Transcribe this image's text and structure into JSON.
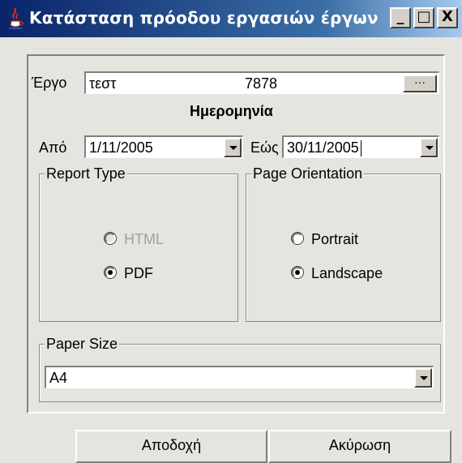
{
  "window": {
    "title": "Κατάσταση πρόοδου εργασιών έργων",
    "minimize_glyph": "_",
    "maximize_glyph": "□",
    "close_glyph": "X"
  },
  "project": {
    "label": "Έργο",
    "name": "τεστ",
    "code": "7878",
    "browse_label": "···"
  },
  "date": {
    "heading": "Ημερομηνία",
    "from_label": "Από",
    "from_value": "1/11/2005",
    "to_label": "Εώς",
    "to_value": "30/11/2005"
  },
  "report_type": {
    "title": "Report Type",
    "options": [
      {
        "label": "HTML",
        "selected": false,
        "enabled": false
      },
      {
        "label": "PDF",
        "selected": true,
        "enabled": true
      }
    ]
  },
  "orientation": {
    "title": "Page Orientation",
    "options": [
      {
        "label": "Portrait",
        "selected": false,
        "enabled": true
      },
      {
        "label": "Landscape",
        "selected": true,
        "enabled": true
      }
    ]
  },
  "paper": {
    "title": "Paper Size",
    "value": "A4"
  },
  "buttons": {
    "accept": "Αποδοχή",
    "cancel": "Ακύρωση"
  },
  "colors": {
    "title_bar_start": "#0a246a",
    "title_bar_end": "#a6caf0",
    "disabled_text": "#a0a0a0"
  }
}
